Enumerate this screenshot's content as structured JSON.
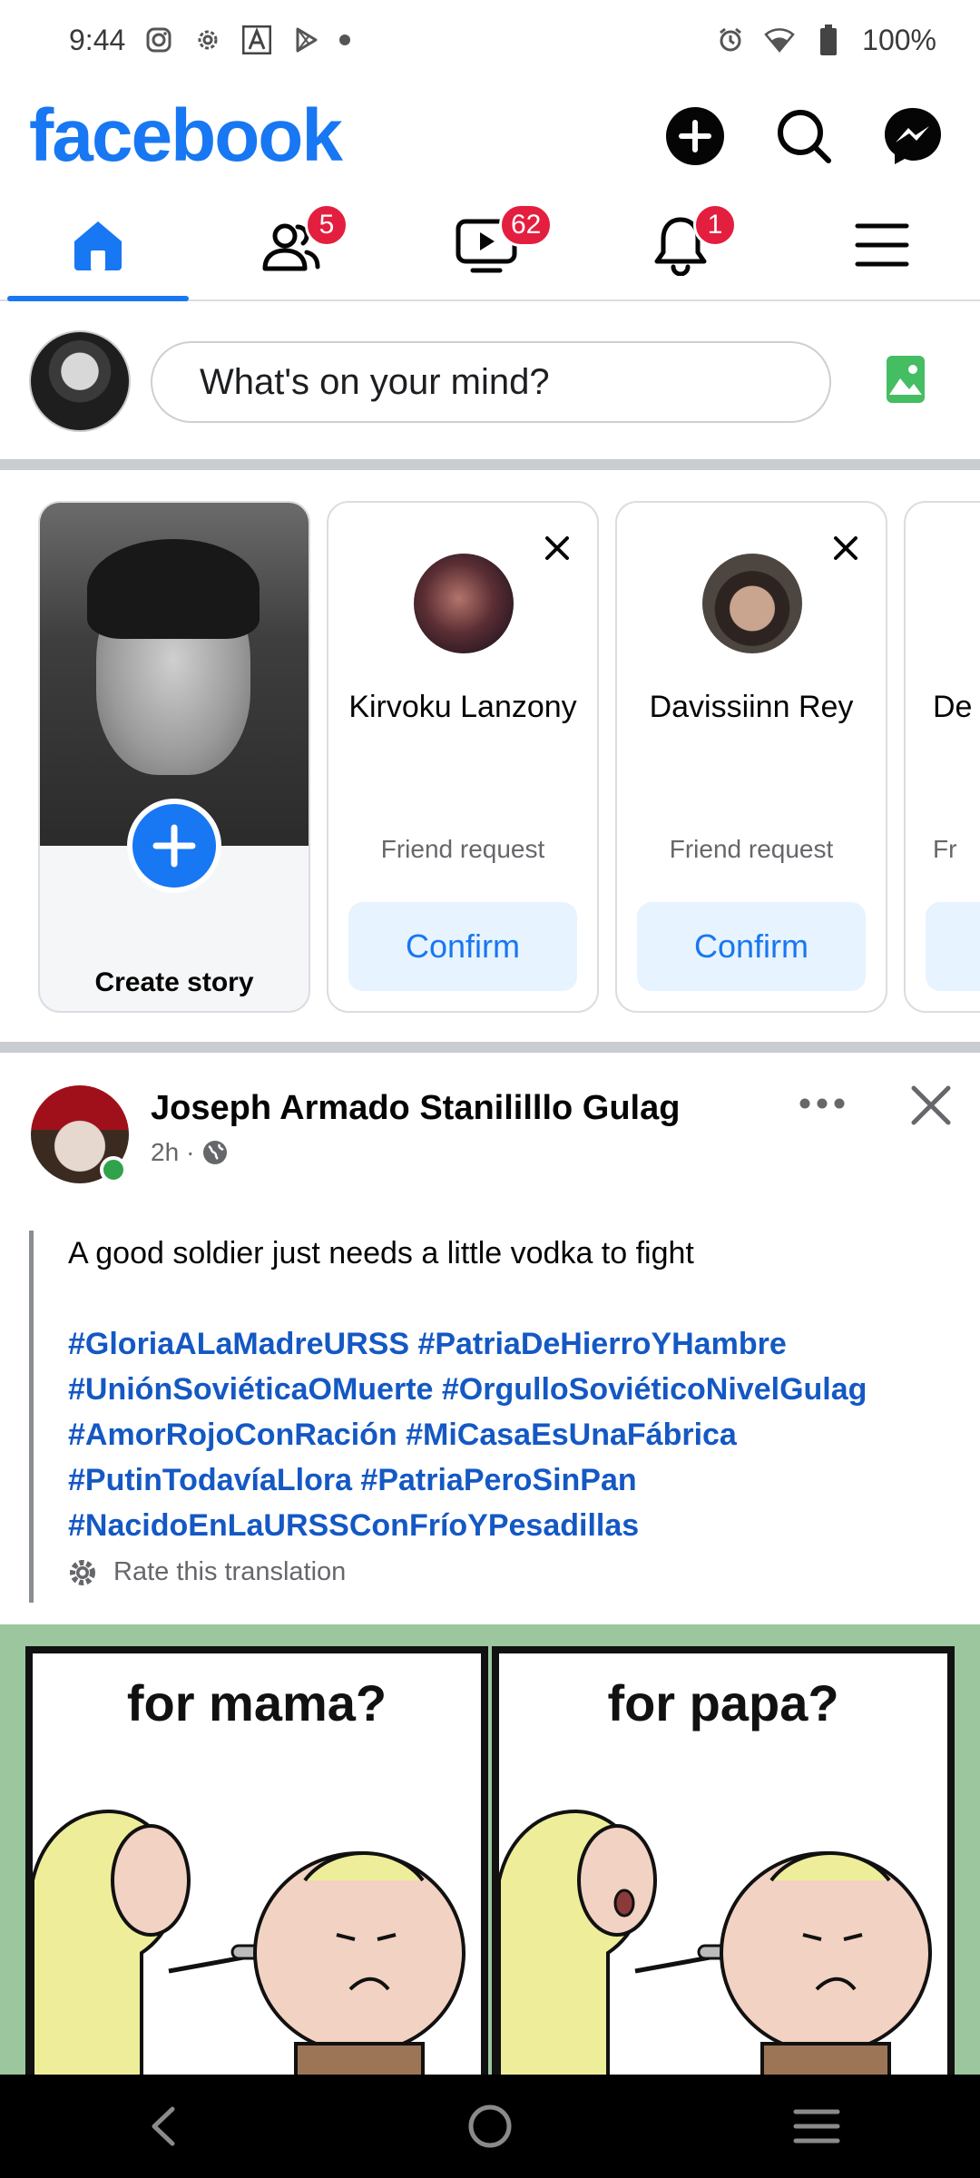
{
  "status_bar": {
    "time": "9:44",
    "battery": "100%",
    "icons": [
      "instagram-icon",
      "settings-gear-icon",
      "app-a-icon",
      "play-store-icon",
      "dot-icon",
      "alarm-icon",
      "wifi-icon",
      "battery-icon"
    ]
  },
  "header": {
    "logo": "facebook",
    "actions": [
      "create-plus-icon",
      "search-icon",
      "messenger-icon"
    ]
  },
  "nav_tabs": [
    {
      "name": "home",
      "badge": ""
    },
    {
      "name": "friends",
      "badge": "5"
    },
    {
      "name": "video",
      "badge": "62"
    },
    {
      "name": "notifications",
      "badge": "1"
    },
    {
      "name": "menu",
      "badge": ""
    }
  ],
  "composer": {
    "placeholder": "What's on your mind?"
  },
  "stories": {
    "create_label": "Create story",
    "requests": [
      {
        "name": "Kirvoku Lanzony",
        "subtitle": "Friend request",
        "button": "Confirm"
      },
      {
        "name": "Davissiinn Rey",
        "subtitle": "Friend request",
        "button": "Confirm"
      },
      {
        "name": "De Tru",
        "subtitle": "Fr",
        "button": ""
      }
    ]
  },
  "post": {
    "author": "Joseph Armado Stanililllo Gulag",
    "time": "2h",
    "audience_icon": "globe-icon",
    "text": "A good soldier just needs a little vodka to fight",
    "hashtags": [
      "#GloriaALaMadreURSS #PatriaDeHierroYHambre",
      "#UniónSoviéticaOMuerte #OrgulloSoviéticoNivelGulag",
      "#AmorRojoConRación #MiCasaEsUnaFábrica",
      "#PutinTodavíaLlora #PatriaPeroSinPan",
      "#NacidoEnLaURSSConFríoYPesadillas"
    ],
    "rate_translation": "Rate this translation",
    "comic": {
      "caption_left": "for mama?",
      "caption_right": "for papa?"
    }
  },
  "colors": {
    "brand": "#1877f2",
    "badge": "#e41e3f",
    "hashtag": "#1458c4",
    "comic_bg": "#9cc69e"
  }
}
